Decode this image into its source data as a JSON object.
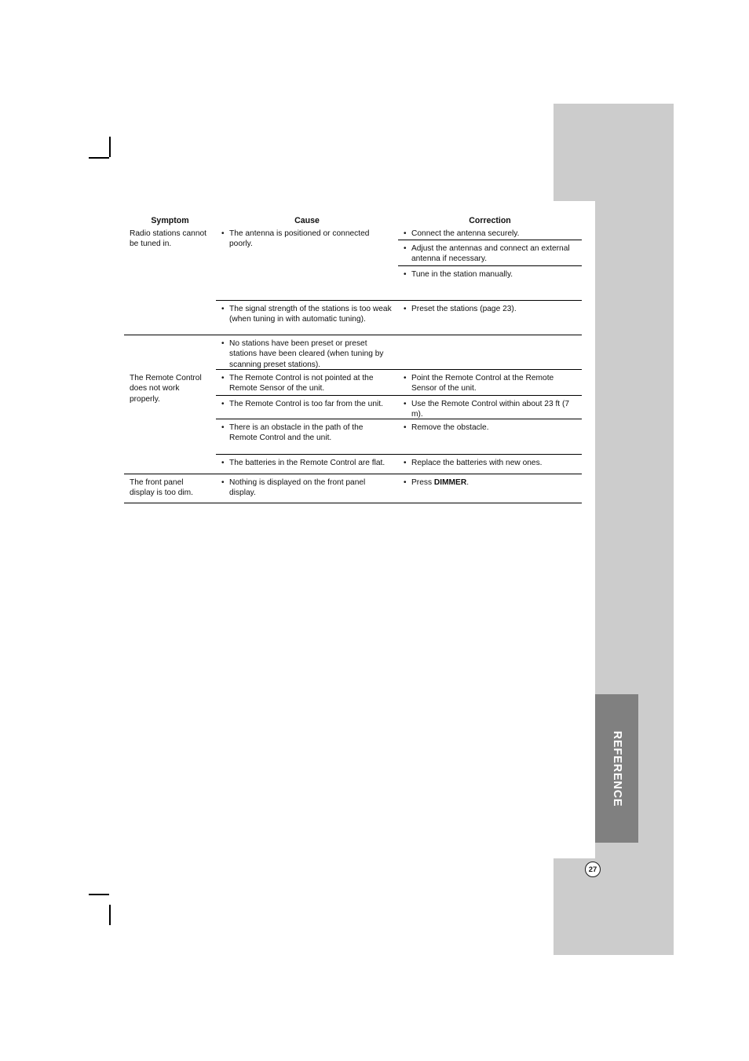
{
  "page": {
    "number": "27",
    "section_tab": "REFERENCE"
  },
  "table": {
    "headers": {
      "symptom": "Symptom",
      "cause": "Cause",
      "correction": "Correction"
    },
    "sections": [
      {
        "symptom": "Radio stations cannot be tuned in.",
        "causes": [
          "The antenna is positioned or  connected poorly.",
          "The signal strength of the stations is too weak (when tuning in with automatic tuning).",
          "No stations have been preset or preset stations have been cleared (when tuning by scanning preset stations)."
        ],
        "corrections": [
          "Connect the antenna securely.",
          "Adjust the antennas and connect an external antenna if necessary.",
          "Tune in the station manually.",
          "Preset the stations (page 23)."
        ]
      },
      {
        "symptom": "The Remote Control does not work properly.",
        "causes": [
          "The Remote Control is not pointed at the Remote Sensor of the unit.",
          "The Remote Control is too far from the unit.",
          "There is an obstacle in the path of the Remote Control and the unit.",
          "The batteries in the Remote Control are flat."
        ],
        "corrections": [
          "Point the Remote Control at the Remote Sensor of the unit.",
          "Use the Remote Control within about 23 ft (7 m).",
          "Remove the obstacle.",
          "Replace the batteries with new ones."
        ]
      },
      {
        "symptom": "The front panel display is too dim.",
        "causes": [
          "Nothing is displayed on the front panel display."
        ],
        "corrections_rich": [
          {
            "prefix": "Press ",
            "bold": "DIMMER",
            "suffix": "."
          }
        ]
      }
    ]
  },
  "colors": {
    "page_background": "#ffffff",
    "side_panel_gray": "#cccccc",
    "tab_gray": "#808080",
    "rule_black": "#000000",
    "text": "#111111"
  }
}
